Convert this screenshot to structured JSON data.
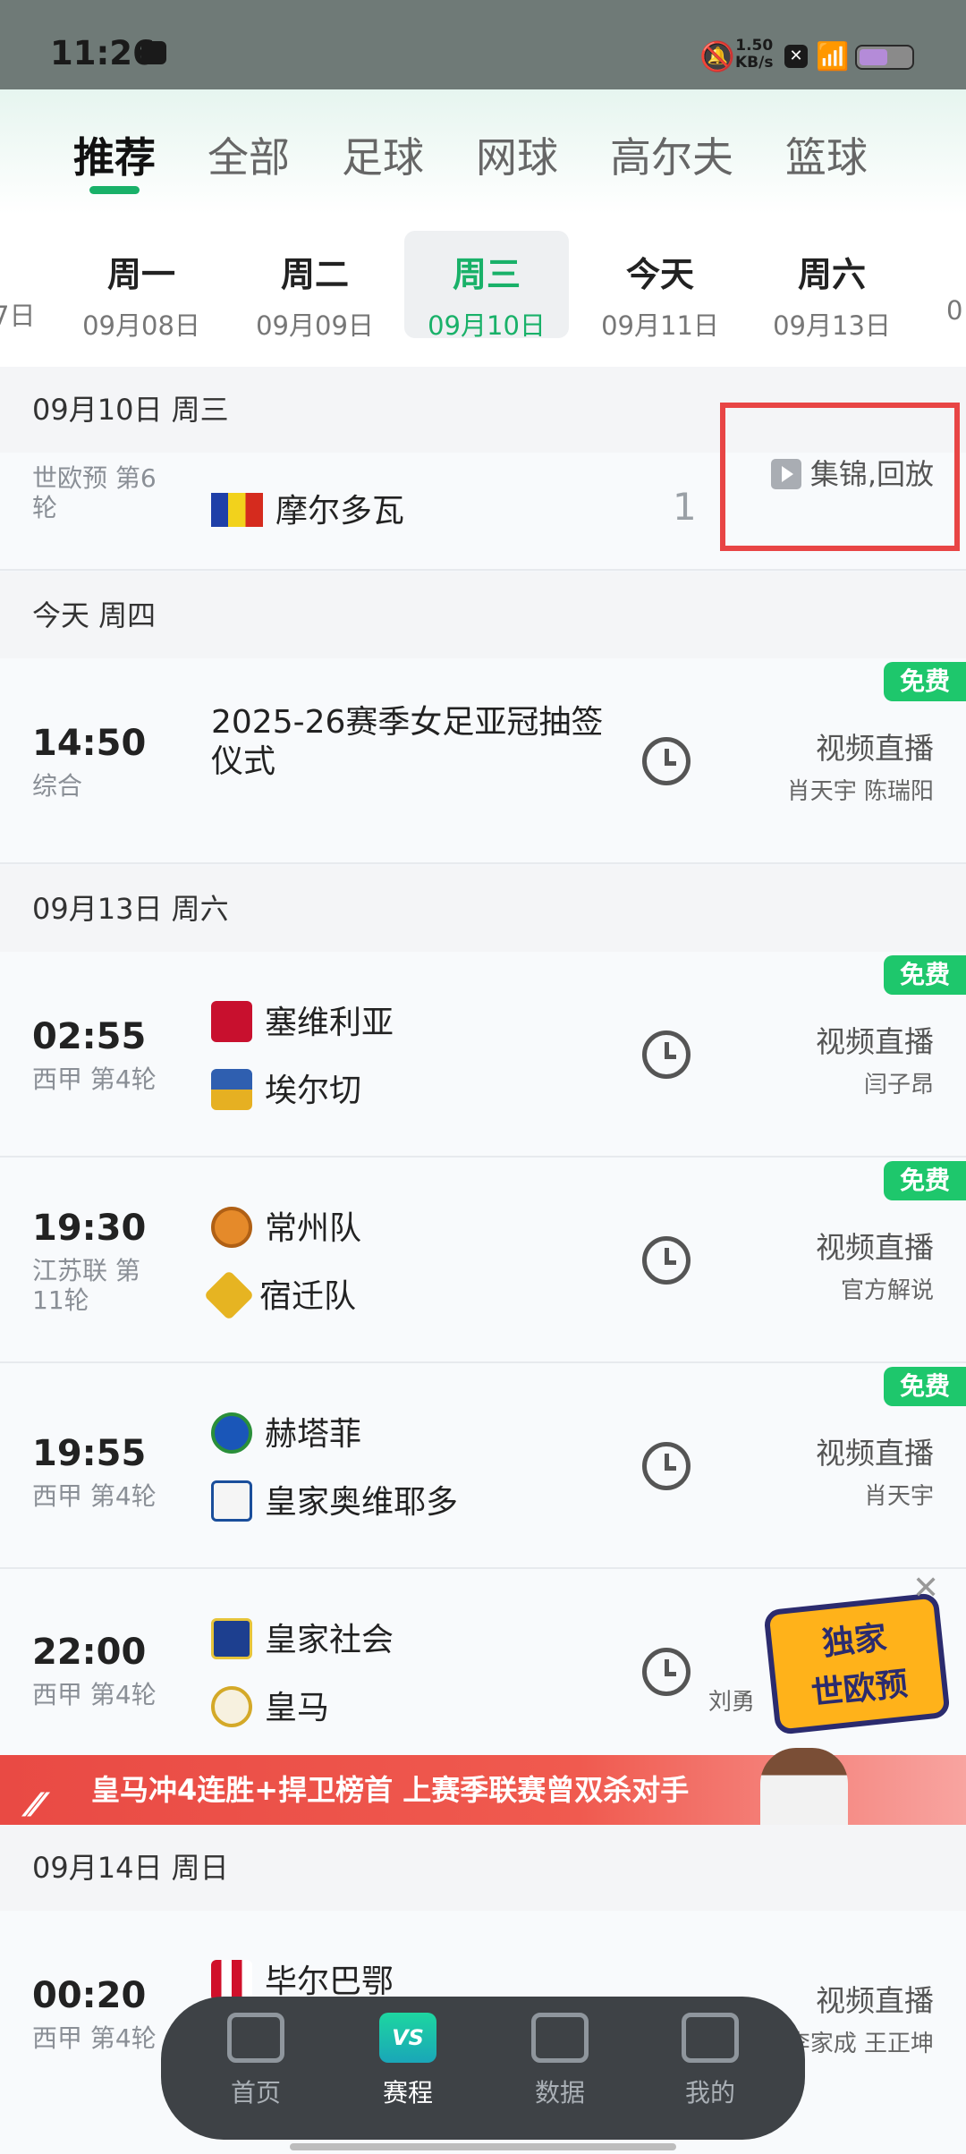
{
  "status_bar": {
    "time": "11:26",
    "net_speed_value": "1.50",
    "net_speed_unit": "KB/s",
    "battery_percent": 55
  },
  "sport_tabs": [
    "推荐",
    "全部",
    "足球",
    "网球",
    "高尔夫",
    "篮球"
  ],
  "day_tabs": [
    {
      "day": "周一",
      "date": "09月08日"
    },
    {
      "day": "周二",
      "date": "09月09日"
    },
    {
      "day": "周三",
      "date": "09月10日"
    },
    {
      "day": "今天",
      "date": "09月11日"
    },
    {
      "day": "周六",
      "date": "09月13日"
    }
  ],
  "edge_left": "7日",
  "edge_right": "0",
  "sections": [
    "09月10日 周三",
    "今天 周四",
    "09月13日 周六",
    "09月14日 周日"
  ],
  "replay": {
    "league": "世欧预 第6轮",
    "team": "摩尔多瓦",
    "score": "1",
    "replay_label": "集锦,回放"
  },
  "free_label": "免费",
  "matches": [
    {
      "time": "14:50",
      "league": "综合",
      "title": "2025-26赛季女足亚冠抽签仪式",
      "broadcast": "视频直播",
      "commentators": "肖天宇 陈瑞阳"
    },
    {
      "time": "02:55",
      "league": "西甲 第4轮",
      "home": "塞维利亚",
      "away": "埃尔切",
      "broadcast": "视频直播",
      "commentators": "闫子昂"
    },
    {
      "time": "19:30",
      "league": "江苏联 第11轮",
      "home": "常州队",
      "away": "宿迁队",
      "broadcast": "视频直播",
      "commentators": "官方解说"
    },
    {
      "time": "19:55",
      "league": "西甲 第4轮",
      "home": "赫塔菲",
      "away": "皇家奥维耶多",
      "broadcast": "视频直播",
      "commentators": "肖天宇"
    },
    {
      "time": "22:00",
      "league": "西甲 第4轮",
      "home": "皇家社会",
      "away": "皇马",
      "broadcast": "视频直播",
      "commentators": "刘勇"
    },
    {
      "time": "00:20",
      "league": "西甲 第4轮",
      "home": "毕尔巴鄂",
      "broadcast": "视频直播",
      "commentators": "李家成 王正坤"
    }
  ],
  "banner": {
    "text": "皇马冲4连胜+捍卫榜首 上赛季联赛曾双杀对手"
  },
  "promo": {
    "line1": "独家",
    "line2": "世欧预"
  },
  "bottom_nav": [
    {
      "label": "首页"
    },
    {
      "label": "赛程",
      "icon_text": "VS"
    },
    {
      "label": "数据"
    },
    {
      "label": "我的"
    }
  ]
}
